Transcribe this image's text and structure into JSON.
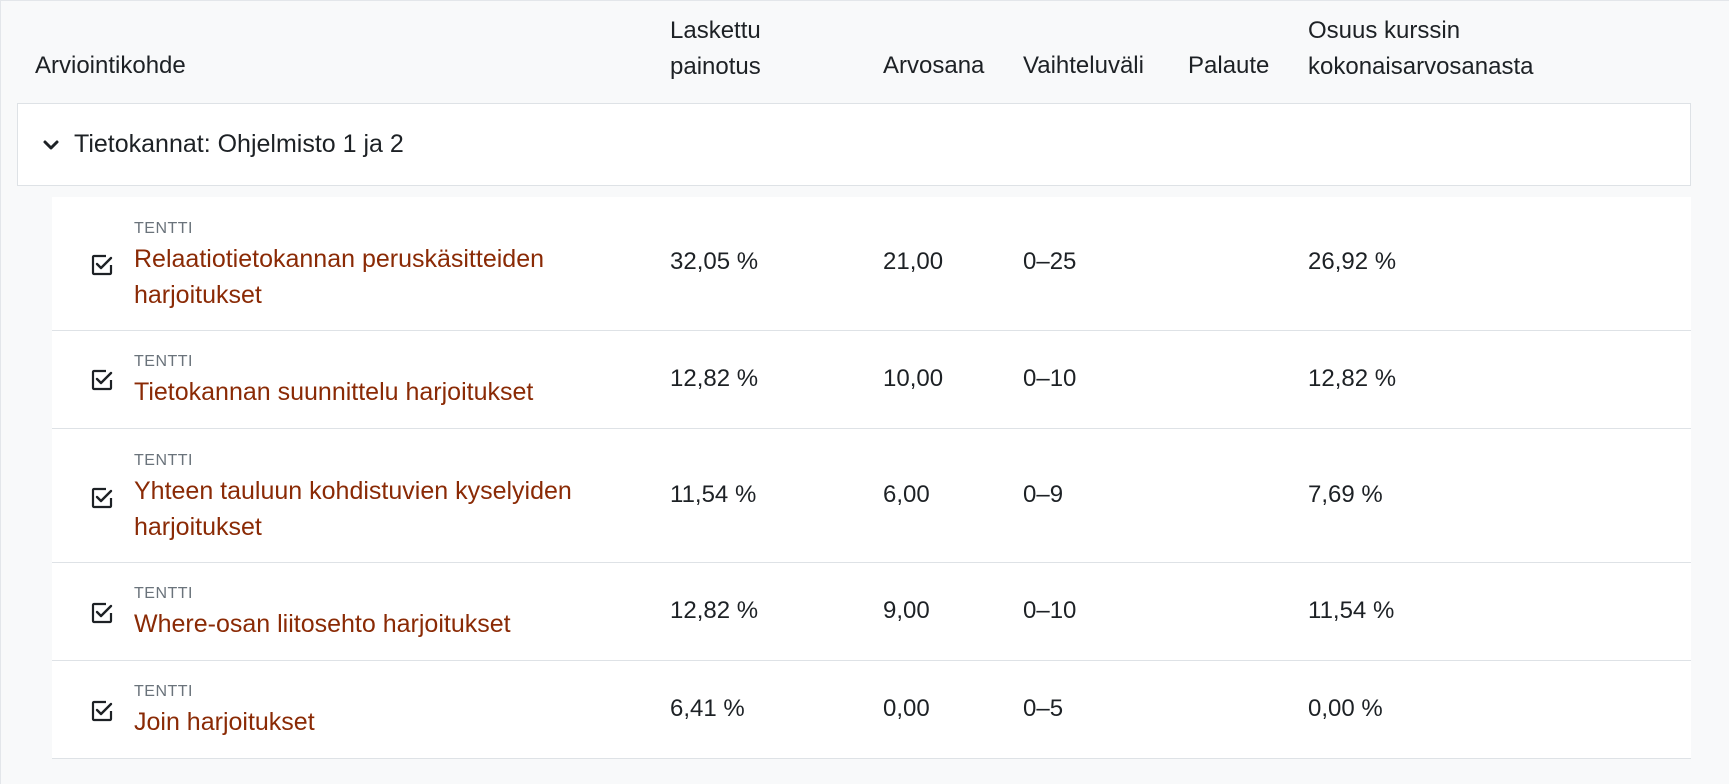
{
  "header": {
    "col_item": "Arviointikohde",
    "col_weight_line1": "Laskettu",
    "col_weight_line2": "painotus",
    "col_grade": "Arvosana",
    "col_range": "Vaihteluväli",
    "col_feedback": "Palaute",
    "col_contrib_line1": "Osuus kurssin",
    "col_contrib_line2": "kokonaisarvosanasta"
  },
  "category": {
    "title": "Tietokannat: Ohjelmisto 1 ja 2",
    "expanded": true
  },
  "items": [
    {
      "type": "TENTTI",
      "name_line1": "Relaatiotietokannan peruskäsitteiden",
      "name_line2": "harjoitukset",
      "weight": "32,05 %",
      "grade": "21,00",
      "range": "0–25",
      "feedback": "",
      "contribution": "26,92 %"
    },
    {
      "type": "TENTTI",
      "name_line1": "Tietokannan suunnittelu harjoitukset",
      "name_line2": "",
      "weight": "12,82 %",
      "grade": "10,00",
      "range": "0–10",
      "feedback": "",
      "contribution": "12,82 %"
    },
    {
      "type": "TENTTI",
      "name_line1": "Yhteen tauluun kohdistuvien kyselyiden",
      "name_line2": "harjoitukset",
      "weight": "11,54 %",
      "grade": "6,00",
      "range": "0–9",
      "feedback": "",
      "contribution": "7,69 %"
    },
    {
      "type": "TENTTI",
      "name_line1": "Where-osan liitosehto harjoitukset",
      "name_line2": "",
      "weight": "12,82 %",
      "grade": "9,00",
      "range": "0–10",
      "feedback": "",
      "contribution": "11,54 %"
    },
    {
      "type": "TENTTI",
      "name_line1": "Join harjoitukset",
      "name_line2": "",
      "weight": "6,41 %",
      "grade": "0,00",
      "range": "0–5",
      "feedback": "",
      "contribution": "0,00 %"
    }
  ],
  "icons": {
    "category_toggle": "chevron-down-icon",
    "item_type": "quiz-checkbox-icon"
  },
  "colors": {
    "link": "#8a2a05",
    "page_bg": "#f8f9fa",
    "row_bg": "#ffffff",
    "border": "#dee2e6",
    "muted": "#6a737b"
  }
}
